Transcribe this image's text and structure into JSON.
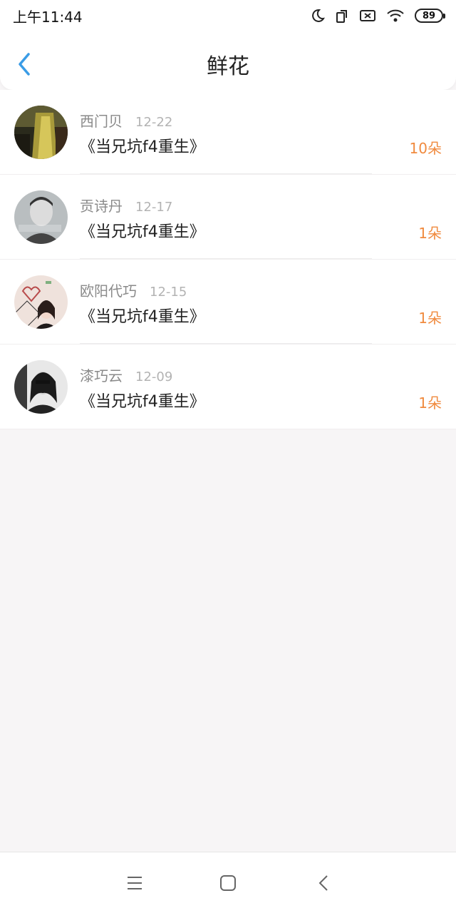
{
  "status_bar": {
    "time": "上午11:44",
    "battery": "89",
    "icons": [
      "moon-icon",
      "screen-rotate-icon",
      "sim-blocked-icon",
      "wifi-icon",
      "battery-icon"
    ]
  },
  "header": {
    "title": "鲜花",
    "back_icon": "chevron-left-icon",
    "accent_color": "#3a9ce6"
  },
  "gifts": [
    {
      "name": "西门贝",
      "date": "12-22",
      "book": "《当兄坑f4重生》",
      "count": "10朵"
    },
    {
      "name": "贡诗丹",
      "date": "12-17",
      "book": "《当兄坑f4重生》",
      "count": "1朵"
    },
    {
      "name": "欧阳代巧",
      "date": "12-15",
      "book": "《当兄坑f4重生》",
      "count": "1朵"
    },
    {
      "name": "漆巧云",
      "date": "12-09",
      "book": "《当兄坑f4重生》",
      "count": "1朵"
    }
  ],
  "colors": {
    "count": "#f08a3e",
    "name": "#8a8a8a",
    "date": "#b3b3b3",
    "background": "#f7f5f6"
  },
  "system_nav": [
    "menu-icon",
    "home-icon",
    "back-icon"
  ]
}
